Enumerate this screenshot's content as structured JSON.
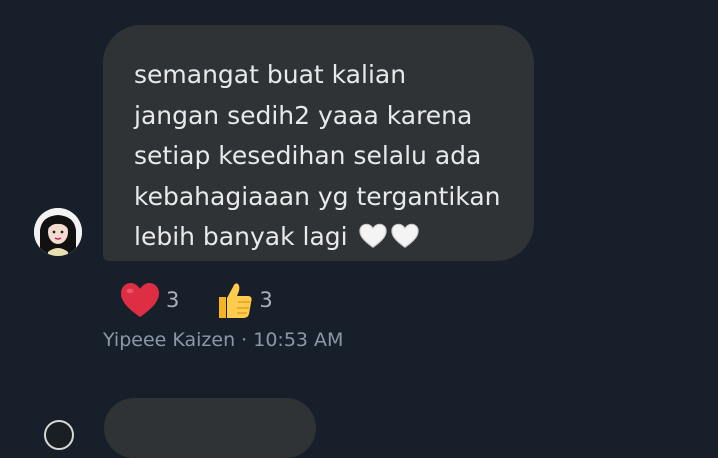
{
  "message": {
    "lines": [
      "semangat buat kalian",
      "jangan sedih2 yaaa karena",
      "setiap kesedihan selalu ada",
      "kebahagiaaan yg tergantikan",
      "lebih banyak lagi"
    ],
    "trailing_emojis": [
      "white-heart",
      "white-heart"
    ]
  },
  "reactions": [
    {
      "emoji": "red-heart",
      "count": "3"
    },
    {
      "emoji": "thumbs-up",
      "count": "3"
    }
  ],
  "meta": "Yipeee Kaizen · 10:53 AM"
}
